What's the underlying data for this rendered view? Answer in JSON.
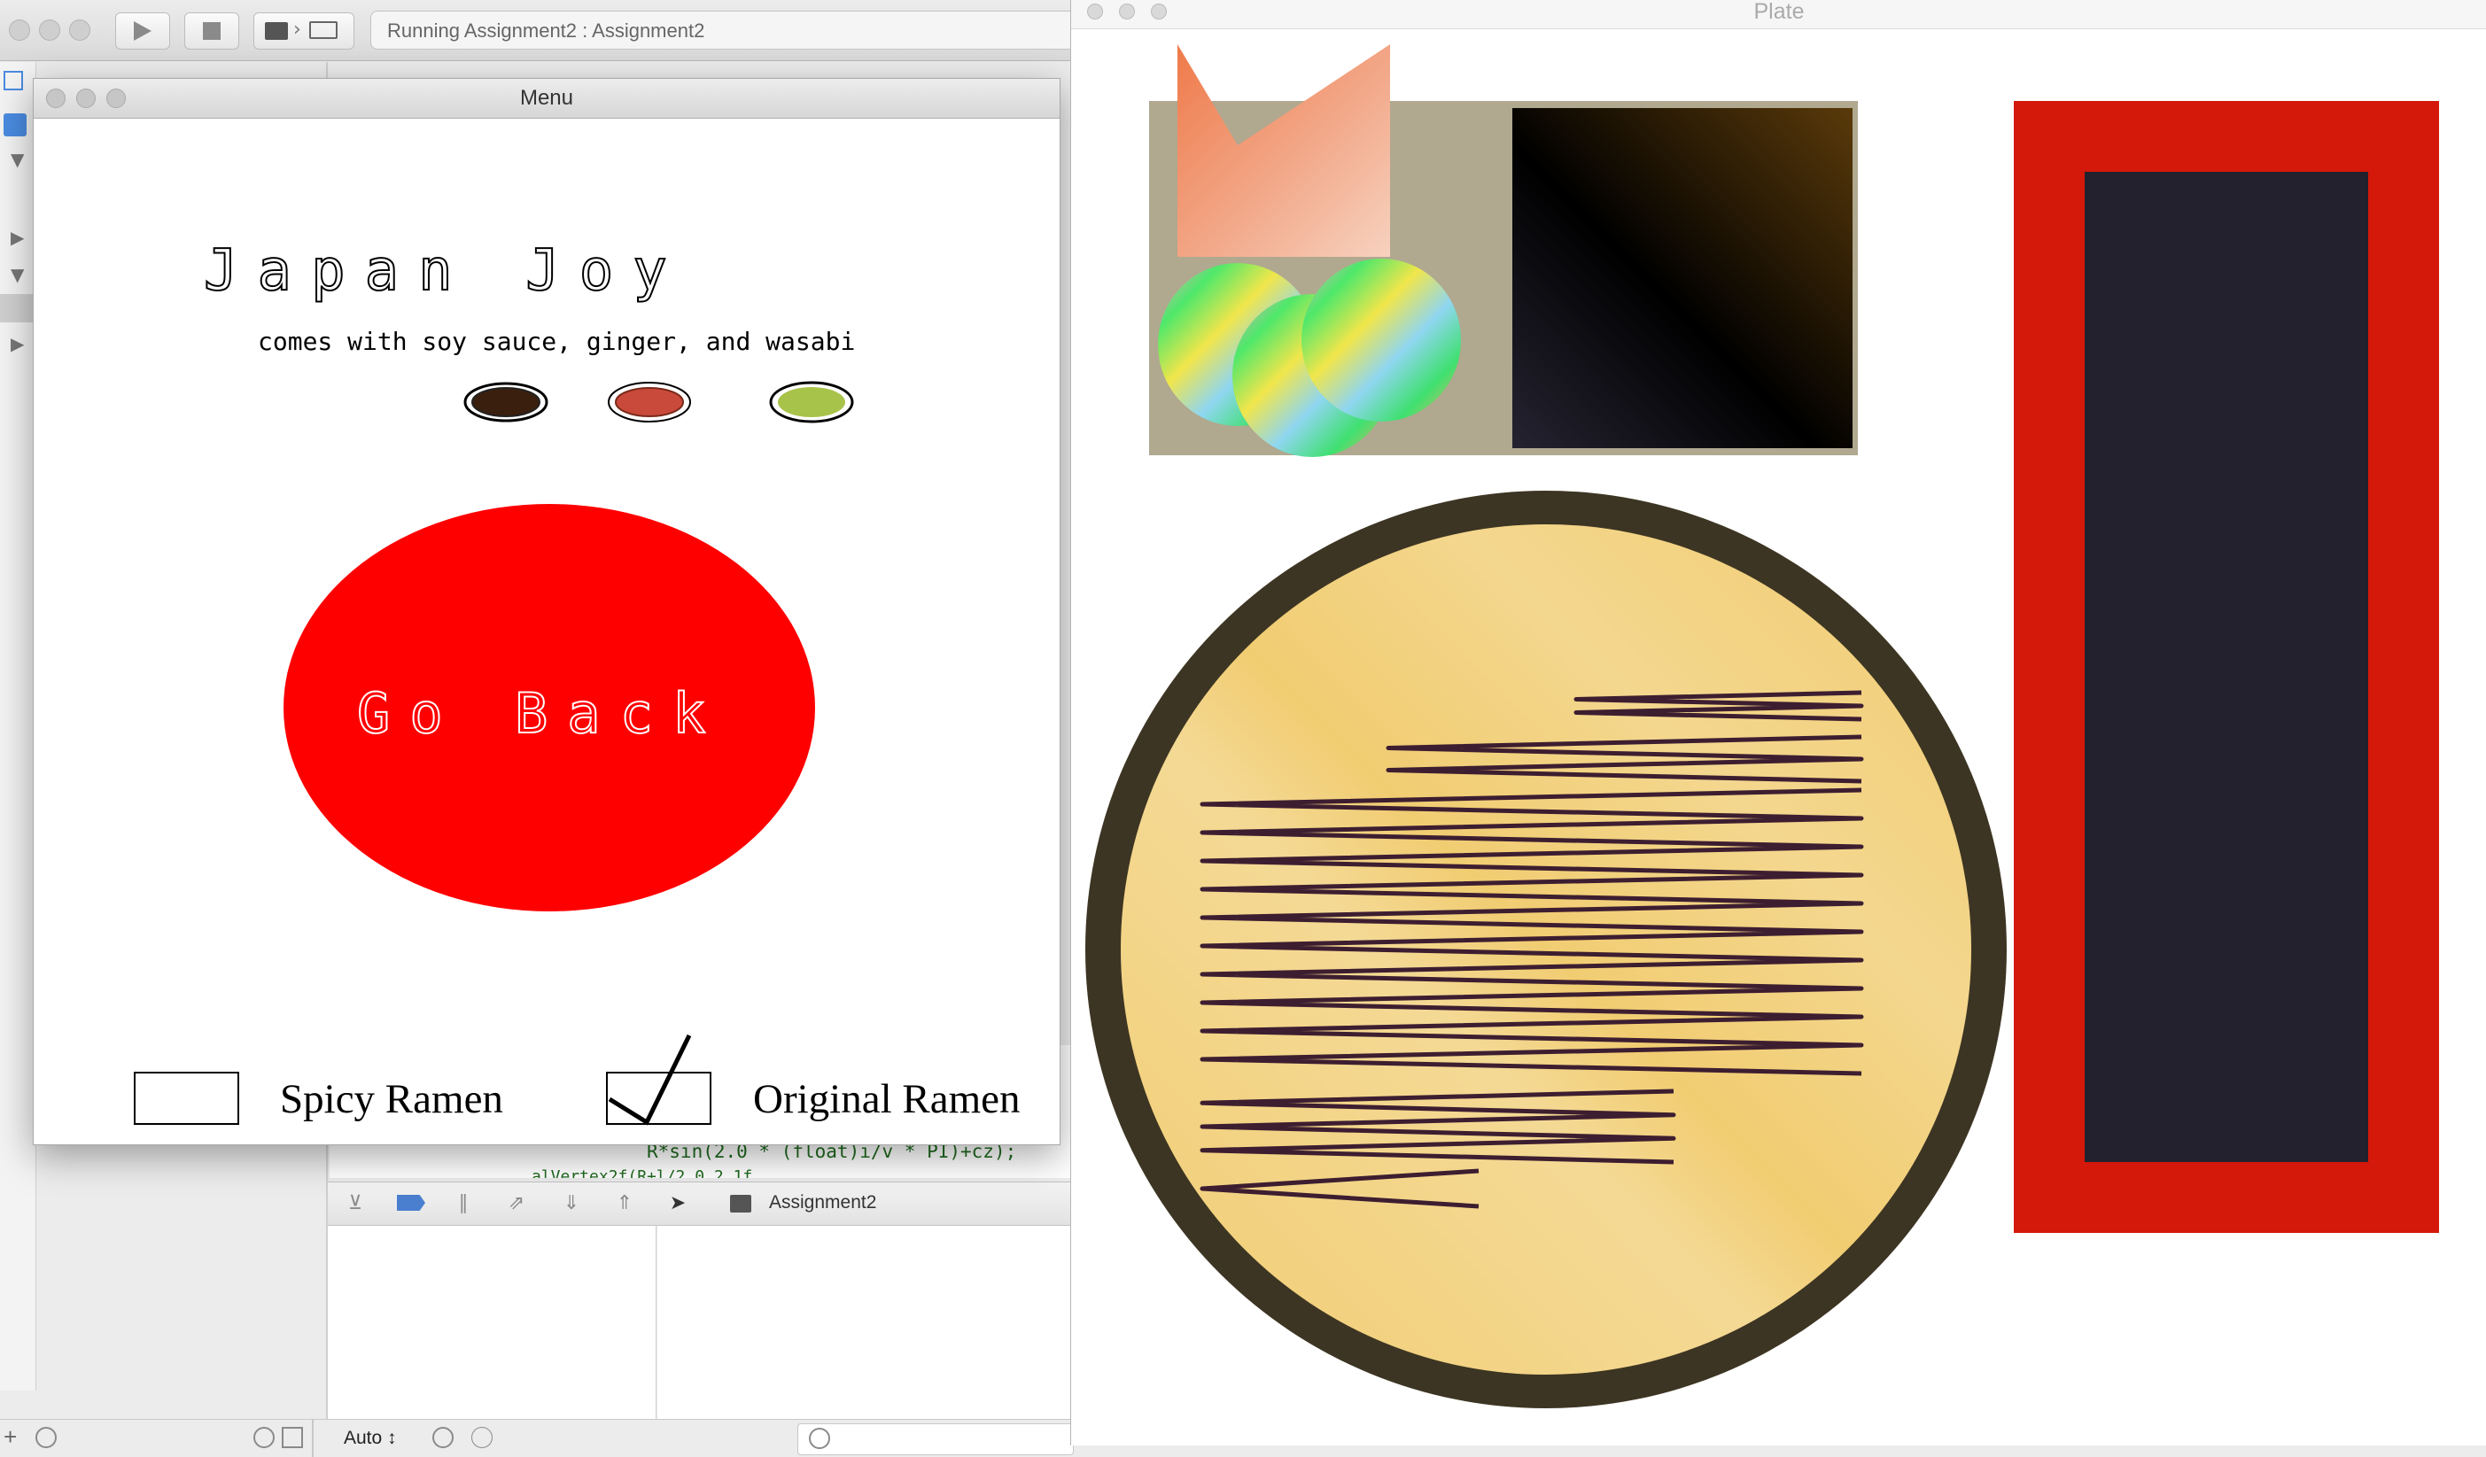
{
  "xcode": {
    "activity": "Running Assignment2 : Assignment2",
    "code_line": "R*sin(2.0 * (float)i/v * PI)+cz);",
    "code_line_partial": "alVertex2f(R+l/2.0,2.1f",
    "debug_target": "Assignment2",
    "variables_scope": "Auto ↕"
  },
  "menu_window": {
    "title": "Menu",
    "heading": "Japan Joy",
    "subheading": "comes with soy sauce, ginger, and wasabi",
    "condiments": [
      {
        "name": "soy sauce",
        "color": "#3b1f0e"
      },
      {
        "name": "ginger",
        "color": "#c9493a"
      },
      {
        "name": "wasabi",
        "color": "#a8c34a"
      }
    ],
    "go_back_label": "Go Back",
    "go_back_color": "#ff0000",
    "options": [
      {
        "label": "Spicy Ramen",
        "checked": false
      },
      {
        "label": "Original Ramen",
        "checked": true
      }
    ]
  },
  "plate_window": {
    "title": "Plate",
    "colors": {
      "tray": "#b0a88f",
      "bowl_rim": "#3d3523",
      "broth": "#f1cd72",
      "noodle": "#3d1e30",
      "chopstick_box_border": "#d4180a",
      "chopstick_box_inner": "#23212e"
    }
  }
}
